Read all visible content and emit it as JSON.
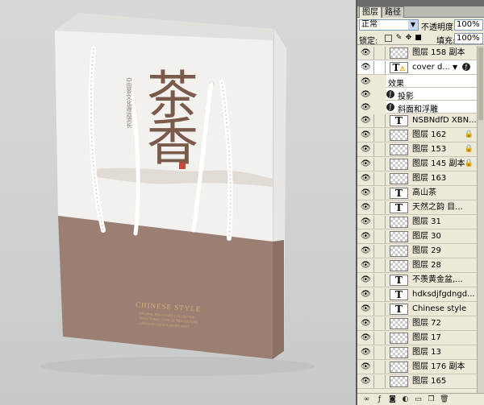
{
  "canvas": {
    "calligraphy_title": "茶香",
    "vertical_text": "中国茶文化源远流长",
    "product_label": "CHINESE STYLE",
    "product_subtext": [
      "NATURAL TEA LEAVES COLLECTION",
      "TRADITIONAL CHINESE TEA CULTURE",
      "LOREM IPSUM DOLOR SIT AMET"
    ],
    "colors": {
      "bag_top": "#f3f1ee",
      "bag_bottom": "#9c7f73",
      "gold_text": "#d2b373"
    }
  },
  "panel": {
    "tabs": [
      {
        "label": "图层"
      },
      {
        "label": "路径"
      }
    ],
    "blend_mode": "正常",
    "opacity_label": "不透明度:",
    "opacity_value": "100%",
    "lock_label": "锁定:",
    "fill_label": "填充:",
    "fill_value": "100%",
    "layers": [
      {
        "name": "图层 158 副本",
        "kind": "image",
        "locked": false
      },
      {
        "name": "cover d...",
        "kind": "text-warning",
        "locked": false
      },
      {
        "name": "效果",
        "kind": "effect-header"
      },
      {
        "name": "投影",
        "kind": "effect"
      },
      {
        "name": "斜面和浮雕",
        "kind": "effect"
      },
      {
        "name": "NSBNdfD XBN...",
        "kind": "text",
        "locked": false
      },
      {
        "name": "图层 162",
        "kind": "image",
        "locked": true
      },
      {
        "name": "图层 153",
        "kind": "image",
        "locked": true
      },
      {
        "name": "图层 145 副本",
        "kind": "image",
        "locked": true
      },
      {
        "name": "图层 163",
        "kind": "image",
        "locked": false
      },
      {
        "name": "高山茶",
        "kind": "text",
        "locked": false
      },
      {
        "name": "天然之韵 目...",
        "kind": "text",
        "locked": false
      },
      {
        "name": "图层 31",
        "kind": "image",
        "locked": false
      },
      {
        "name": "图层 30",
        "kind": "image",
        "locked": false
      },
      {
        "name": "图层 29",
        "kind": "image",
        "locked": false
      },
      {
        "name": "图层 28",
        "kind": "image",
        "locked": false
      },
      {
        "name": "不羡黄金盆,...",
        "kind": "text",
        "locked": false
      },
      {
        "name": "hdksdjfgdngd...",
        "kind": "text",
        "locked": false
      },
      {
        "name": "Chinese style",
        "kind": "text",
        "locked": false
      },
      {
        "name": "图层 72",
        "kind": "image",
        "locked": false
      },
      {
        "name": "图层 17",
        "kind": "image",
        "locked": false
      },
      {
        "name": "图层 13",
        "kind": "image",
        "locked": false
      },
      {
        "name": "图层 176 副本",
        "kind": "image",
        "locked": false
      },
      {
        "name": "图层 165",
        "kind": "image",
        "locked": false
      }
    ]
  }
}
